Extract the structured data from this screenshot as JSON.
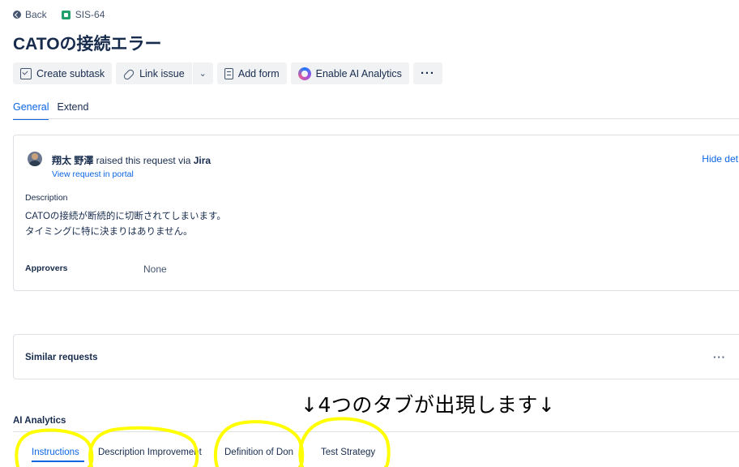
{
  "nav": {
    "back_label": "Back",
    "issue_key": "SIS-64"
  },
  "issue": {
    "title": "CATOの接続エラー"
  },
  "toolbar": {
    "create_subtask": "Create subtask",
    "link_issue": "Link issue",
    "add_form": "Add form",
    "enable_ai": "Enable AI Analytics"
  },
  "tabs": [
    {
      "label": "General",
      "active": true
    },
    {
      "label": "Extend",
      "active": false
    }
  ],
  "request": {
    "reporter": "翔太 野澤",
    "raised_text": " raised this request via ",
    "channel": "Jira",
    "portal_link": "View request in portal",
    "hide_details": "Hide det",
    "description_label": "Description",
    "description_lines": [
      "CATOの接続が断続的に切断されてしまいます。",
      "タイミングに特に決まりはありません。"
    ],
    "approvers_label": "Approvers",
    "approvers_value": "None"
  },
  "similar": {
    "title": "Similar requests"
  },
  "annotation": {
    "text": "↓4つのタブが出現します↓",
    "highlight_color": "#ffff00"
  },
  "ai_analytics": {
    "title": "AI Analytics",
    "tabs": [
      {
        "label": "Instructions",
        "active": true
      },
      {
        "label": "Description Improvement"
      },
      {
        "label": "Definition of Don"
      },
      {
        "label": "Test Strategy"
      }
    ]
  },
  "colors": {
    "accent": "#0c66e4",
    "text": "#172b4d",
    "subtle": "#44546f",
    "issue_type": "#22a06b"
  }
}
